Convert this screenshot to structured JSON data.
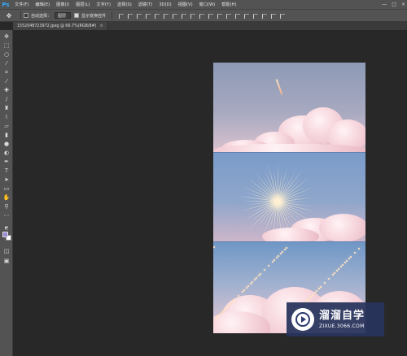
{
  "app": {
    "logo": "Ps"
  },
  "menu": [
    "文件(F)",
    "编辑(E)",
    "图像(I)",
    "图层(L)",
    "文字(Y)",
    "选择(S)",
    "滤镜(T)",
    "3D(D)",
    "视图(V)",
    "窗口(W)",
    "帮助(H)"
  ],
  "window_controls": [
    "—",
    "□",
    "×"
  ],
  "options": {
    "auto_select_label": "自动选择：",
    "auto_select_value": "图层",
    "show_transform_label": "显示变换控件"
  },
  "document_tab": {
    "label": "1552048723972.jpeg @ 66.7%(RGB/8#)",
    "close": "×"
  },
  "colors": {
    "foreground": "#9b8ad6",
    "background": "#ffffff",
    "accent": "#31a8ff"
  },
  "watermark": {
    "title": "溜溜自学",
    "url": "ZIXUE.3066.COM"
  }
}
